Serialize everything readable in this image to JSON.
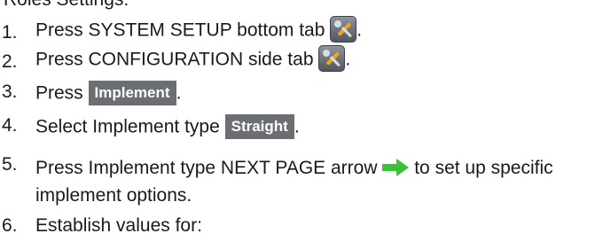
{
  "heading": "Roles Settings:",
  "steps": [
    {
      "num": "1.",
      "before": "Press SYSTEM SETUP bottom tab",
      "icon": "wrench-screwdriver-icon",
      "after": "."
    },
    {
      "num": "2.",
      "before": "Press CONFIGURATION side tab",
      "icon": "wrench-screwdriver-icon",
      "after": "."
    },
    {
      "num": "3.",
      "before": "Press",
      "button": "Implement",
      "after": "."
    },
    {
      "num": "4.",
      "before": "Select Implement type",
      "button": "Straight",
      "after": "."
    },
    {
      "num": "5.",
      "before": "Press Implement type NEXT PAGE arrow",
      "icon": "green-right-arrow-icon",
      "after": "to set up specific implement options."
    },
    {
      "num": "6.",
      "before": "Establish values for:"
    }
  ],
  "colors": {
    "button_bg": "#6b6e72",
    "arrow": "#3cc03a",
    "tool_tile": "#6a7078"
  }
}
